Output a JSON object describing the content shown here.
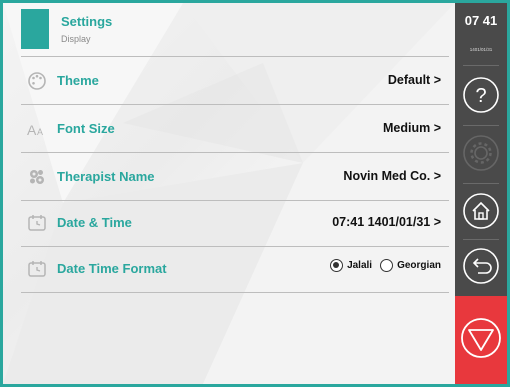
{
  "header": {
    "title": "Settings",
    "subtitle": "Display"
  },
  "rows": [
    {
      "label": "Theme",
      "value": "Default >",
      "icon": "palette-icon"
    },
    {
      "label": "Font Size",
      "value": "Medium >",
      "icon": "font-size-icon"
    },
    {
      "label": "Therapist Name",
      "value": "Novin Med Co. >",
      "icon": "gear-cluster-icon"
    },
    {
      "label": "Date & Time",
      "value": "07:41 1401/01/31 >",
      "icon": "calendar-icon"
    },
    {
      "label": "Date Time Format",
      "icon": "calendar-icon",
      "options": [
        {
          "label": "Jalali",
          "selected": true
        },
        {
          "label": "Georgian",
          "selected": false
        }
      ]
    }
  ],
  "sidebar": {
    "time": "07 41",
    "date": "1401/01/31",
    "help_glyph": "?",
    "buttons": [
      "help-icon",
      "settings-icon",
      "home-icon",
      "back-icon",
      "stop-icon"
    ]
  },
  "colors": {
    "accent": "#2aa79e",
    "panel": "#4a4a4a",
    "stop": "#e8383d"
  }
}
